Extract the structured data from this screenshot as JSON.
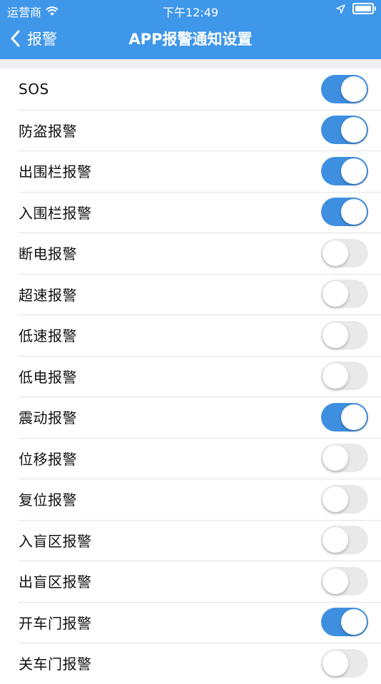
{
  "status_bar": {
    "carrier": "运营商",
    "time": "下午12:49"
  },
  "nav": {
    "back_label": "报警",
    "title": "APP报警通知设置"
  },
  "colors": {
    "accent": "#3f97ea",
    "switch_on": "#3f8fe0",
    "switch_off": "#e9e9ea"
  },
  "alarms": [
    {
      "label": "SOS",
      "enabled": true
    },
    {
      "label": "防盗报警",
      "enabled": true
    },
    {
      "label": "出围栏报警",
      "enabled": true
    },
    {
      "label": "入围栏报警",
      "enabled": true
    },
    {
      "label": "断电报警",
      "enabled": false
    },
    {
      "label": "超速报警",
      "enabled": false
    },
    {
      "label": "低速报警",
      "enabled": false
    },
    {
      "label": "低电报警",
      "enabled": false
    },
    {
      "label": "震动报警",
      "enabled": true
    },
    {
      "label": "位移报警",
      "enabled": false
    },
    {
      "label": "复位报警",
      "enabled": false
    },
    {
      "label": "入盲区报警",
      "enabled": false
    },
    {
      "label": "出盲区报警",
      "enabled": false
    },
    {
      "label": "开车门报警",
      "enabled": true
    },
    {
      "label": "关车门报警",
      "enabled": false
    }
  ]
}
